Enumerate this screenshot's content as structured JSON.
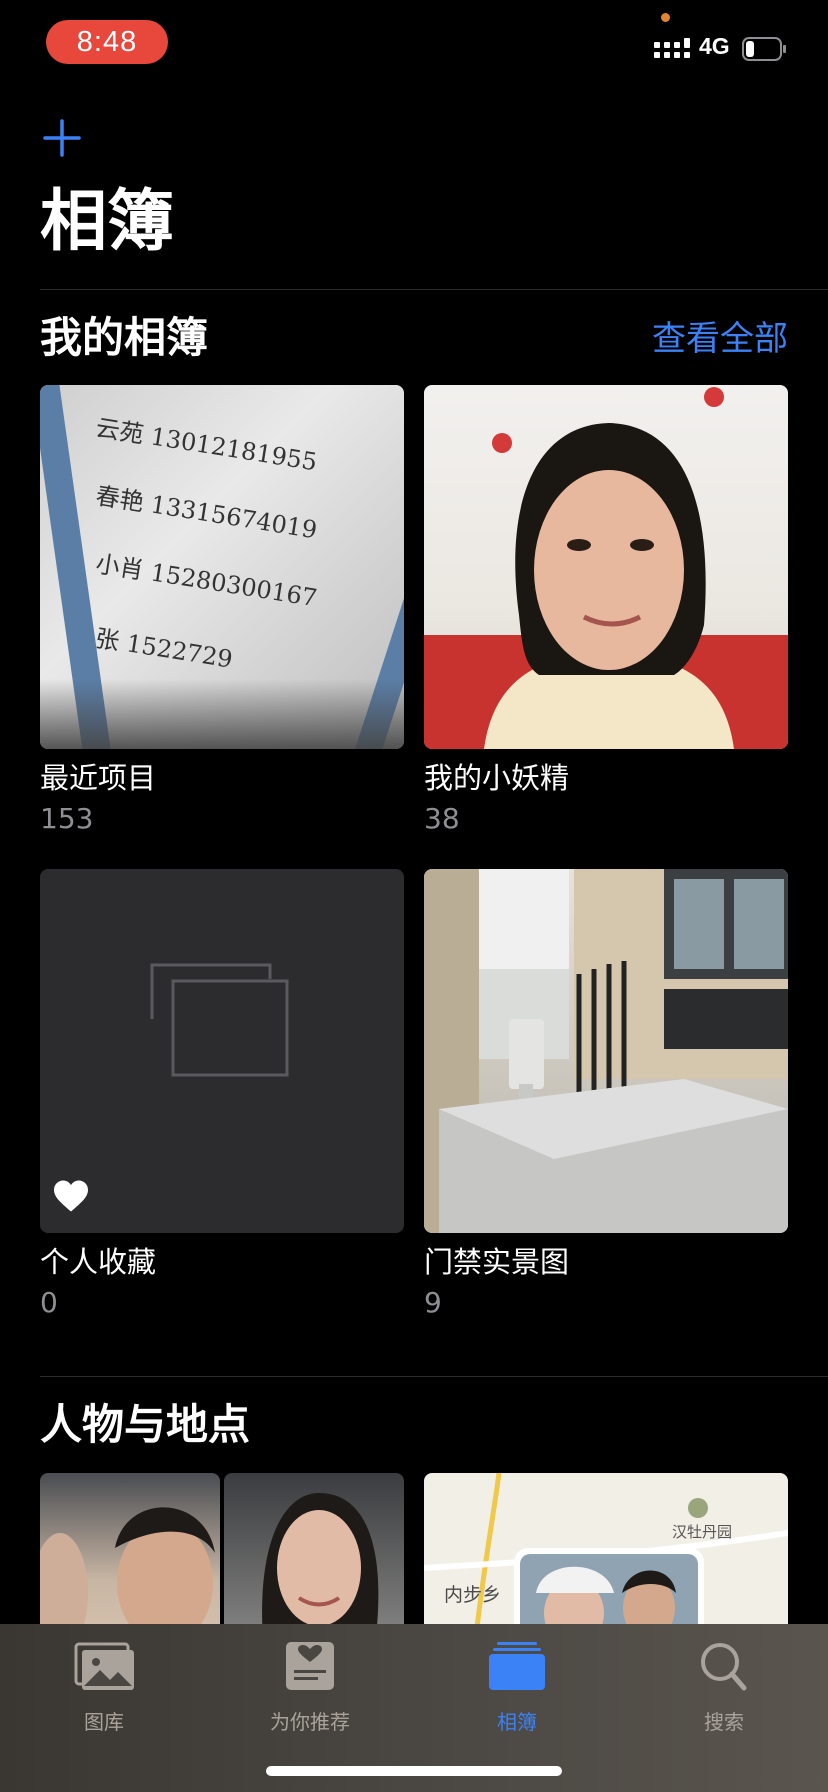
{
  "status_bar": {
    "time": "8:48",
    "network": "4G",
    "battery_level": 0.25,
    "time_pill_color": "#e8473c",
    "camera_dot_color": "#e38433"
  },
  "header": {
    "add_icon": "plus-icon",
    "title": "相簿"
  },
  "my_albums": {
    "section_title": "我的相簿",
    "see_all_label": "查看全部",
    "albums": [
      {
        "name": "最近项目",
        "count": "153"
      },
      {
        "name": "我的小妖精",
        "count": "38"
      },
      {
        "name": "个人收藏",
        "count": "0",
        "icon": "heart-icon"
      },
      {
        "name": "门禁实景图",
        "count": "9"
      }
    ],
    "recent_thumb_lines": [
      "云苑 13012181955",
      "春艳 13315674019",
      "小肖 15280300167",
      "张 1522729"
    ]
  },
  "people_places": {
    "section_title": "人物与地点",
    "map_labels": [
      "汉牡丹园",
      "内步乡"
    ]
  },
  "tab_bar": {
    "tabs": [
      {
        "label": "图库",
        "icon": "photos-library-icon"
      },
      {
        "label": "为你推荐",
        "icon": "for-you-icon"
      },
      {
        "label": "相簿",
        "icon": "albums-icon",
        "active": true
      },
      {
        "label": "搜索",
        "icon": "search-icon"
      }
    ]
  },
  "colors": {
    "accent": "#3b82f6",
    "background": "#000000",
    "secondary_text": "#8e8e93",
    "placeholder_tile": "#2c2c2e"
  }
}
